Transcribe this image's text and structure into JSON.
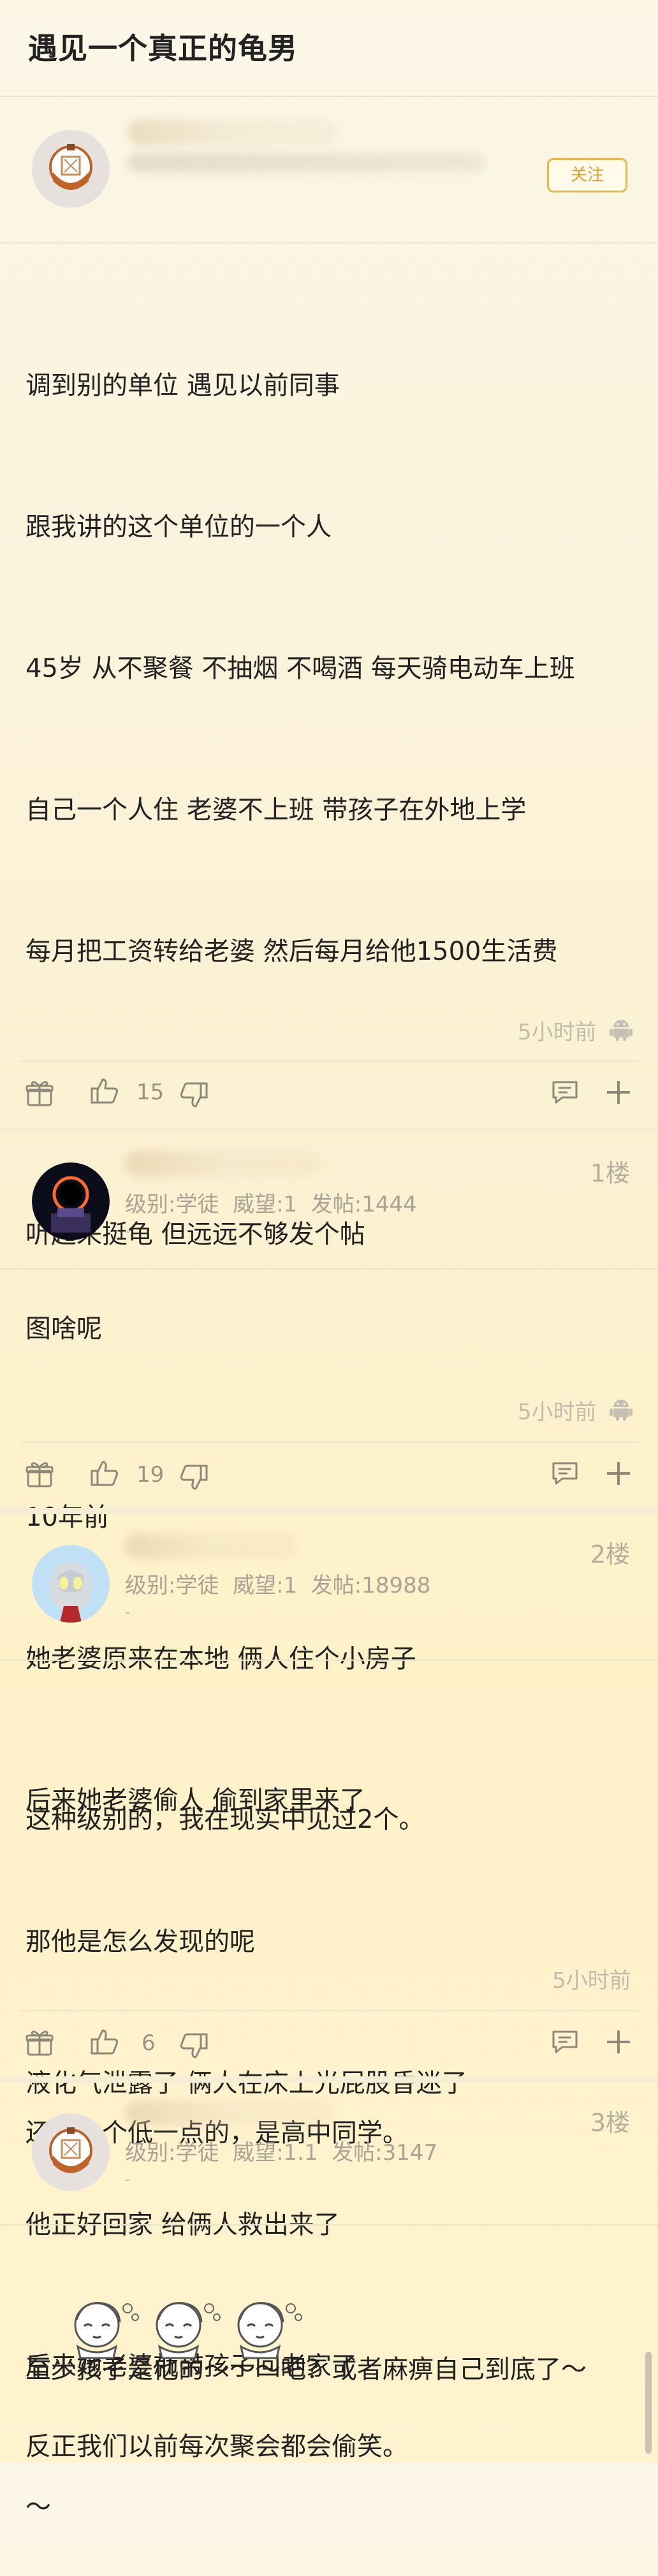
{
  "page": {
    "title": "遇见一个真正的龟男"
  },
  "op": {
    "follow_label": "关注",
    "lines": [
      "调到别的单位 遇见以前同事",
      "跟我讲的这个单位的一个人",
      "45岁 从不聚餐 不抽烟 不喝酒 每天骑电动车上班",
      "自己一个人住 老婆不上班 带孩子在外地上学",
      "每月把工资转给老婆 然后每月给他1500生活费",
      "",
      "听起来挺龟 但远远不够发个帖",
      "",
      "10年前",
      "她老婆原来在本地 俩人住个小房子",
      "后来她老婆偷人 偷到家里来了",
      "那他是怎么发现的呢",
      "液化气泄露了 俩人在床上光屁股昏迷了",
      "他正好回家 给俩人救出来了",
      "后来她老婆就带孩子回老家了"
    ],
    "time": "5小时前",
    "likes": "15"
  },
  "replies": [
    {
      "floor": "1楼",
      "level": "级别:学徒  威望:1  发帖:1444",
      "dash": "-",
      "text": "图啥呢",
      "time": "5小时前",
      "likes": "19"
    },
    {
      "floor": "2楼",
      "level": "级别:学徒  威望:1  发帖:18988",
      "dash": "-",
      "text_lines": [
        "这种级别的，我在现实中见过2个。",
        "",
        "还有一个低一点的，是高中同学。",
        "",
        "反正我们以前每次聚会都会偷笑。"
      ],
      "time": "5小时前",
      "likes": "6"
    },
    {
      "floor": "3楼",
      "level": "级别:学徒  威望:1.1  发帖:3147",
      "dash": "-",
      "text_lines": [
        "至少孩子是他的～～～吧？或者麻痹自己到底了～",
        "～"
      ]
    }
  ],
  "icons": {
    "gift": "gift-icon",
    "like": "thumbs-up-icon",
    "dislike": "thumbs-down-icon",
    "comment": "comment-icon",
    "add": "plus-icon",
    "android": "android-icon"
  },
  "colors": {
    "accent": "#e8b84a",
    "background": "#fbf3dc",
    "muted": "#c3bcab"
  }
}
